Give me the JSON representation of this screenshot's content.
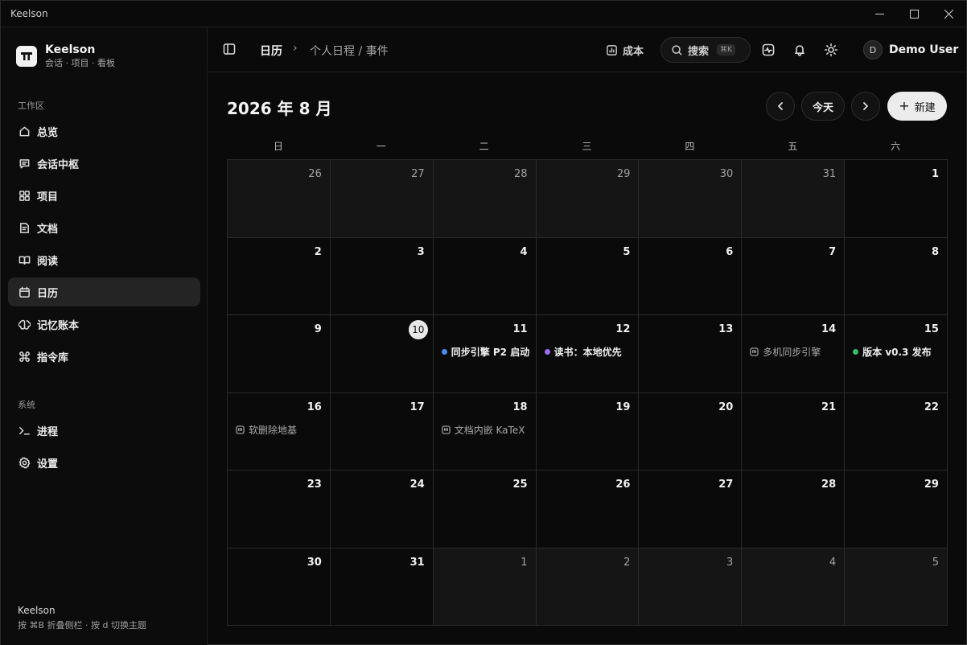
{
  "window": {
    "title": "Keelson"
  },
  "brand": {
    "name": "Keelson",
    "subtitle": "会话 · 项目 · 看板"
  },
  "sidebar": {
    "workspace_label": "工作区",
    "items": [
      {
        "label": "总览",
        "icon": "home-icon"
      },
      {
        "label": "会话中枢",
        "icon": "message-icon"
      },
      {
        "label": "项目",
        "icon": "grid-icon"
      },
      {
        "label": "文档",
        "icon": "document-icon"
      },
      {
        "label": "阅读",
        "icon": "book-icon"
      },
      {
        "label": "日历",
        "icon": "calendar-icon",
        "active": true
      },
      {
        "label": "记忆账本",
        "icon": "brain-icon"
      },
      {
        "label": "指令库",
        "icon": "command-icon"
      }
    ],
    "system_label": "系统",
    "system_items": [
      {
        "label": "进程",
        "icon": "terminal-icon"
      },
      {
        "label": "设置",
        "icon": "gear-icon"
      }
    ],
    "footer": {
      "title": "Keelson",
      "hint": "按 ⌘B 折叠侧栏 · 按 d 切换主题"
    }
  },
  "header": {
    "breadcrumb_root": "日历",
    "breadcrumb_sep": "›",
    "breadcrumb_page": "个人日程 / 事件",
    "cost_label": "成本",
    "search_label": "搜索",
    "search_shortcut": "⌘K",
    "user": {
      "initial": "D",
      "name": "Demo User"
    }
  },
  "calendar": {
    "title": "2026 年 8 月",
    "today_label": "今天",
    "new_label": "新建",
    "weekdays": [
      "日",
      "一",
      "二",
      "三",
      "四",
      "五",
      "六"
    ],
    "weeks": [
      [
        {
          "d": "26",
          "other": true
        },
        {
          "d": "27",
          "other": true
        },
        {
          "d": "28",
          "other": true
        },
        {
          "d": "29",
          "other": true
        },
        {
          "d": "30",
          "other": true
        },
        {
          "d": "31",
          "other": true
        },
        {
          "d": "1"
        }
      ],
      [
        {
          "d": "2"
        },
        {
          "d": "3"
        },
        {
          "d": "4"
        },
        {
          "d": "5"
        },
        {
          "d": "6"
        },
        {
          "d": "7"
        },
        {
          "d": "8"
        }
      ],
      [
        {
          "d": "9"
        },
        {
          "d": "10",
          "today": true
        },
        {
          "d": "11",
          "event": {
            "text": "同步引擎 P2 启动",
            "kind": "dot",
            "color": "#4a8cf0"
          }
        },
        {
          "d": "12",
          "event": {
            "text": "读书：本地优先",
            "kind": "dot",
            "color": "#9b6cf0"
          }
        },
        {
          "d": "13"
        },
        {
          "d": "14",
          "event": {
            "text": "多机同步引擎",
            "kind": "note"
          }
        },
        {
          "d": "15",
          "event": {
            "text": "版本 v0.3 发布",
            "kind": "dot",
            "color": "#35c06a"
          }
        }
      ],
      [
        {
          "d": "16",
          "event": {
            "text": "软删除地基",
            "kind": "note"
          }
        },
        {
          "d": "17"
        },
        {
          "d": "18",
          "event": {
            "text": "文档内嵌 KaTeX",
            "kind": "note"
          }
        },
        {
          "d": "19"
        },
        {
          "d": "20"
        },
        {
          "d": "21"
        },
        {
          "d": "22"
        }
      ],
      [
        {
          "d": "23"
        },
        {
          "d": "24"
        },
        {
          "d": "25"
        },
        {
          "d": "26"
        },
        {
          "d": "27"
        },
        {
          "d": "28"
        },
        {
          "d": "29"
        }
      ],
      [
        {
          "d": "30"
        },
        {
          "d": "31"
        },
        {
          "d": "1",
          "other": true
        },
        {
          "d": "2",
          "other": true
        },
        {
          "d": "3",
          "other": true
        },
        {
          "d": "4",
          "other": true
        },
        {
          "d": "5",
          "other": true
        }
      ]
    ]
  }
}
